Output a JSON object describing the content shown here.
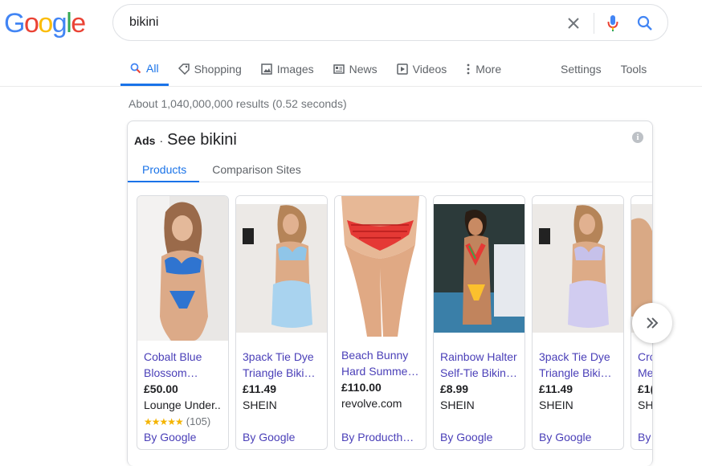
{
  "logo": {
    "letters": [
      "G",
      "o",
      "o",
      "g",
      "l",
      "e"
    ],
    "colors": [
      "#4285f4",
      "#ea4335",
      "#fbbc05",
      "#4285f4",
      "#34a853",
      "#ea4335"
    ]
  },
  "search": {
    "query": "bikini"
  },
  "tabs": [
    {
      "label": "All",
      "icon": "search-icon",
      "active": true
    },
    {
      "label": "Shopping",
      "icon": "tag-icon"
    },
    {
      "label": "Images",
      "icon": "image-icon"
    },
    {
      "label": "News",
      "icon": "news-icon"
    },
    {
      "label": "Videos",
      "icon": "video-icon"
    },
    {
      "label": "More",
      "icon": "dots-vertical-icon"
    }
  ],
  "tools": {
    "settings": "Settings",
    "tools": "Tools"
  },
  "stats": "About 1,040,000,000 results (0.52 seconds)",
  "ads": {
    "label": "Ads",
    "dot": "·",
    "title": "See bikini",
    "info": "i",
    "subtabs": [
      "Products",
      "Comparison Sites"
    ]
  },
  "products": [
    {
      "line1": "Cobalt Blue",
      "line2": "Blossom…",
      "price": "£50.00",
      "seller": "Lounge Under..",
      "stars": "★★★★★",
      "reviews": "(105)",
      "by": "By Google"
    },
    {
      "line1": "3pack Tie Dye",
      "line2": "Triangle Biki…",
      "price": "£11.49",
      "seller": "SHEIN",
      "by": "By Google"
    },
    {
      "line1": "Beach Bunny",
      "line2": "Hard Summe…",
      "price": "£110.00",
      "seller": "revolve.com",
      "by": "By Producth…"
    },
    {
      "line1": "Rainbow Halter",
      "line2": "Self-Tie Bikin…",
      "price": "£8.99",
      "seller": "SHEIN",
      "by": "By Google"
    },
    {
      "line1": "3pack Tie Dye",
      "line2": "Triangle Biki…",
      "price": "£11.49",
      "seller": "SHEIN",
      "by": "By Google"
    },
    {
      "line1": "Cro",
      "line2": "Me",
      "price": "£1(",
      "seller": "SH",
      "by": "By"
    }
  ],
  "colors": {
    "link": "#4a3fb8",
    "accent": "#1a73e8",
    "star": "#f4b400"
  }
}
